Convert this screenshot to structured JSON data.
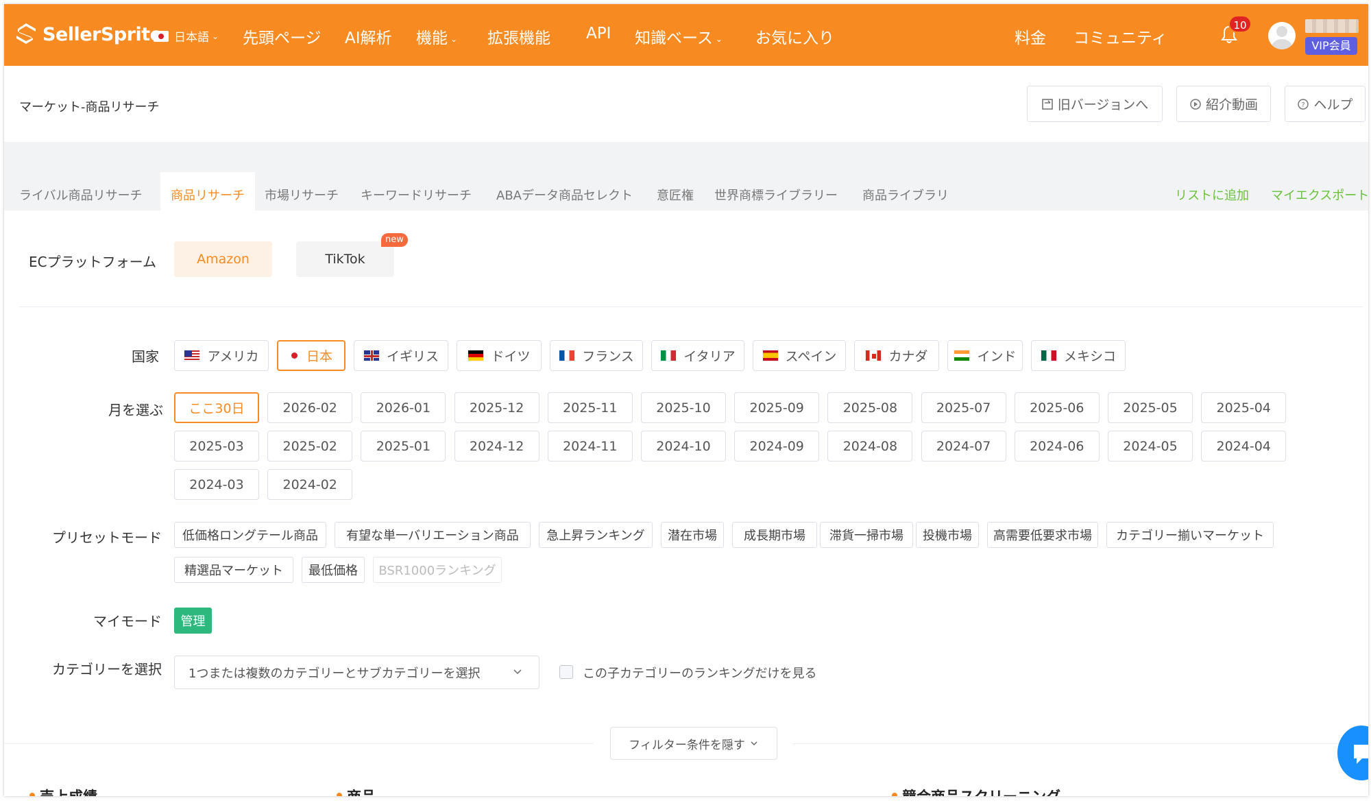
{
  "colors": {
    "brand": "#f78b21",
    "accent_green": "#67c23a",
    "vip": "#5d5fe0",
    "manage": "#2db97d",
    "badge": "#e02424"
  },
  "header": {
    "logo": "SellerSprite",
    "language": "日本語",
    "nav": [
      "先頭ページ",
      "AI解析",
      "機能",
      "拡張機能",
      "API",
      "知識ベース",
      "お気に入り"
    ],
    "nav_right": [
      "料金",
      "コミュニティ"
    ],
    "notification_count": "10",
    "vip_label": "VIP会員"
  },
  "title": "マーケット-商品リサーチ",
  "top_buttons": {
    "old_version": "旧バージョンへ",
    "intro_video": "紹介動画",
    "help": "ヘルプ"
  },
  "tabs": [
    "ライバル商品リサーチ",
    "商品リサーチ",
    "市場リサーチ",
    "キーワードリサーチ",
    "ABAデータ商品セレクト",
    "意匠権",
    "世界商標ライブラリー",
    "商品ライブラリ"
  ],
  "tab_links": [
    "リストに追加",
    "マイエクスポート"
  ],
  "platform": {
    "label": "ECプラットフォーム",
    "options": [
      "Amazon",
      "TikTok"
    ],
    "selected": "Amazon",
    "new_tag": "new"
  },
  "country": {
    "label": "国家",
    "options": [
      "アメリカ",
      "日本",
      "イギリス",
      "ドイツ",
      "フランス",
      "イタリア",
      "スペイン",
      "カナダ",
      "インド",
      "メキシコ"
    ],
    "selected": "日本"
  },
  "month": {
    "label": "月を選ぶ",
    "options": [
      "ここ30日",
      "2026-02",
      "2026-01",
      "2025-12",
      "2025-11",
      "2025-10",
      "2025-09",
      "2025-08",
      "2025-07",
      "2025-06",
      "2025-05",
      "2025-04",
      "2025-03",
      "2025-02",
      "2025-01",
      "2024-12",
      "2024-11",
      "2024-10",
      "2024-09",
      "2024-08",
      "2024-07",
      "2024-06",
      "2024-05",
      "2024-04",
      "2024-03",
      "2024-02"
    ],
    "selected": "ここ30日"
  },
  "preset": {
    "label": "プリセットモード",
    "options": [
      "低価格ロングテール商品",
      "有望な単一バリエーション商品",
      "急上昇ランキング",
      "潜在市場",
      "成長期市場",
      "滞貨一掃市場",
      "投機市場",
      "高需要低要求市場",
      "カテゴリー揃いマーケット",
      "精選品マーケット",
      "最低価格",
      "BSR1000ランキング"
    ],
    "disabled": "BSR1000ランキング"
  },
  "my_mode": {
    "label": "マイモード",
    "manage": "管理"
  },
  "category": {
    "label": "カテゴリーを選択",
    "placeholder": "1つまたは複数のカテゴリーとサブカテゴリーを選択",
    "checkbox_label": "この子カテゴリーのランキングだけを見る"
  },
  "filter_toggle": "フィルター条件を隠す",
  "sections": [
    "売上成績",
    "商品",
    "競合商品スクリーニング"
  ]
}
